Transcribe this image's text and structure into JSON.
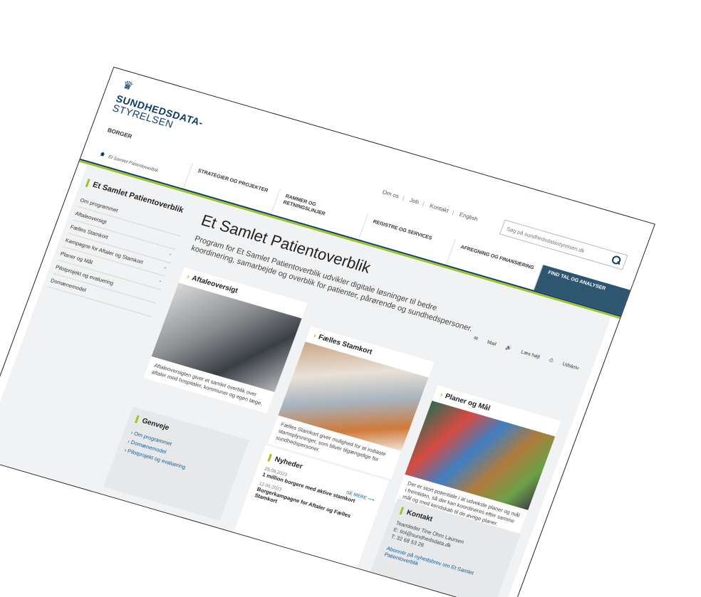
{
  "header": {
    "logo_line1": "SUNDHEDSDATA-",
    "logo_line2": "STYRELSEN",
    "section": "BORGER",
    "util_links": [
      "Om os",
      "Job",
      "Kontakt",
      "English"
    ],
    "search_placeholder": "Søg på sundhedsdatastyrelsen.dk"
  },
  "nav": [
    "",
    "STRATEGIER OG PROJEKTER",
    "RAMMER OG RETNINGSLINJER",
    "REGISTRE OG SERVICES",
    "AFREGNING OG FINANSIERING",
    "FIND TAL OG ANALYSER"
  ],
  "breadcrumb": "Et Samlet Patientoverblik",
  "sidebar": {
    "title": "Et Samlet Patientoverblik",
    "items": [
      {
        "label": "Om programmet",
        "chev": ""
      },
      {
        "label": "Aftaleoversigt",
        "chev": ""
      },
      {
        "label": "Fælles Stamkort",
        "chev": "⌄"
      },
      {
        "label": "Kampagne for Aftaler og Stamkort",
        "chev": "⌄"
      },
      {
        "label": "Planer og Mål",
        "chev": "⌄"
      },
      {
        "label": "Pilotprojekt og evaluering",
        "chev": ""
      },
      {
        "label": "Domænemodel",
        "chev": ""
      }
    ]
  },
  "main": {
    "title": "Et Samlet Patientoverblik",
    "lead": "Program for Et Samlet Patientoverblik udvikler digitale løsninger til bedre koordinering, samarbejde og overblik for patienter, pårørende og sundhedspersoner.",
    "tools": [
      "Mail",
      "Læs højt",
      "Udskriv"
    ]
  },
  "cards": [
    {
      "title": "Aftaleoversigt",
      "text": "Aftaleoversigten giver et samlet overblik over aftaler med hospitaler, kommuner og egen læge."
    },
    {
      "title": "Fælles Stamkort",
      "text": "Fælles Stamkort giver mulighed for at indtaste stamoplysninger, som bliver tilgængelige for sundhedspersoner."
    },
    {
      "title": "Planer og Mål",
      "text": "Der er stort potentiale i at udveksle planer og mål i fremtiden, så der kan koordineres efter samme mål og med kendskab til de øvrige planer."
    }
  ],
  "genveje": {
    "title": "Genveje",
    "links": [
      "Om programmet",
      "Domænemodel",
      "Pilotprojekt og evaluering"
    ]
  },
  "nyheder": {
    "title": "Nyheder",
    "see_more": "SE MERE",
    "items": [
      {
        "date": "29.09.2023",
        "title": "1 million borgere med aktive stamkort"
      },
      {
        "date": "12.05.2023",
        "title": "Borgerkampagne for Aftaler og Fælles Stamkort"
      }
    ]
  },
  "kontakt": {
    "title": "Kontakt",
    "lines": [
      "Teamleder Tine Ohm Laursen",
      "E: tiol@sundhedsdata.dk",
      "T: 32 68 53 26"
    ],
    "link": "Abonnér på nyhedsbrev om Et Samlet Patientoverblik"
  }
}
